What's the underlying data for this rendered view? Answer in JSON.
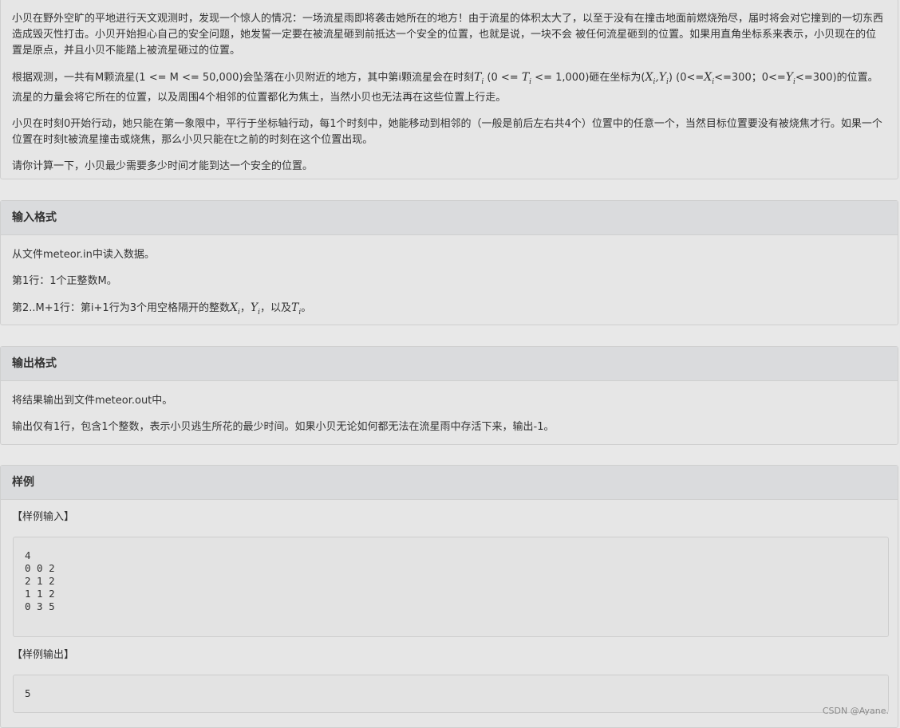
{
  "description": {
    "p1": "小贝在野外空旷的平地进行天文观测时，发现一个惊人的情况：一场流星雨即将袭击她所在的地方！由于流星的体积太大了，以至于没有在撞击地面前燃烧殆尽，届时将会对它撞到的一切东西造成毁灭性打击。小贝开始担心自己的安全问题，她发誓一定要在被流星砸到前抵达一个安全的位置，也就是说，一块不会 被任何流星砸到的位置。如果用直角坐标系来表示，小贝现在的位置是原点，并且小贝不能踏上被流星砸过的位置。",
    "p2_a": "根据观测，一共有M颗流星(1 <= M <= 50,000)会坠落在小贝附近的地方，其中第i颗流星会在时刻",
    "p2_b": " (0 <= ",
    "p2_c": " <= 1,000)砸在坐标为(",
    "p2_d": ") (0<=",
    "p2_e": "<=300；0<=",
    "p2_f": "<=300)的位置。流星的力量会将它所在的位置，以及周围4个相邻的位置都化为焦土，当然小贝也无法再在这些位置上行走。",
    "p3": "小贝在时刻0开始行动，她只能在第一象限中，平行于坐标轴行动，每1个时刻中，她能移动到相邻的（一般是前后左右共4个）位置中的任意一个，当然目标位置要没有被烧焦才行。如果一个位置在时刻t被流星撞击或烧焦，那么小贝只能在t之前的时刻在这个位置出现。",
    "p4": "请你计算一下，小贝最少需要多少时间才能到达一个安全的位置。"
  },
  "math": {
    "T": "T",
    "X": "X",
    "Y": "Y",
    "i": "i",
    "comma": ","
  },
  "input_format": {
    "heading": "输入格式",
    "line1": "从文件meteor.in中读入数据。",
    "line2": "第1行：1个正整数M。",
    "line3_a": "第2..M+1行：第i+1行为3个用空格隔开的整数",
    "line3_sep": "，",
    "line3_b": "，以及",
    "line3_end": "。"
  },
  "output_format": {
    "heading": "输出格式",
    "line1": "将结果输出到文件meteor.out中。",
    "line2": "输出仅有1行，包含1个整数，表示小贝逃生所花的最少时间。如果小贝无论如何都无法在流星雨中存活下来，输出-1。"
  },
  "sample": {
    "heading": "样例",
    "input_label": "【样例输入】",
    "input_text": "4\n0 0 2\n2 1 2\n1 1 2\n0 3 5",
    "output_label": "【样例输出】",
    "output_text": "5"
  },
  "watermark": "CSDN @Ayane."
}
